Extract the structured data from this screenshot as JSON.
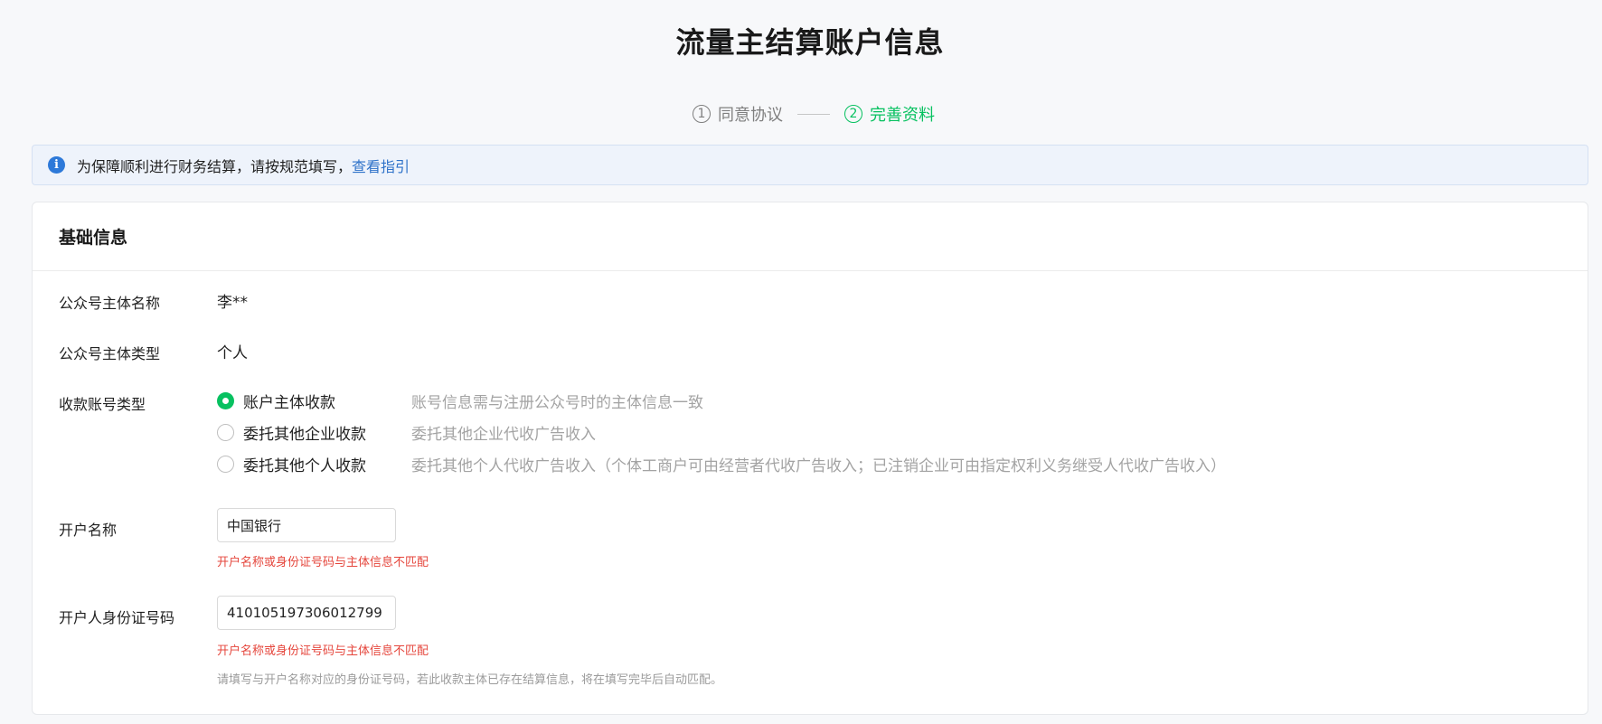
{
  "page": {
    "title": "流量主结算账户信息"
  },
  "steps": [
    {
      "num": "1",
      "label": "同意协议",
      "state": "done"
    },
    {
      "num": "2",
      "label": "完善资料",
      "state": "active"
    }
  ],
  "notice": {
    "text": "为保障顺利进行财务结算，请按规范填写，",
    "link": "查看指引"
  },
  "section": {
    "title": "基础信息"
  },
  "fields": {
    "entity_name": {
      "label": "公众号主体名称",
      "value": "李**"
    },
    "entity_type": {
      "label": "公众号主体类型",
      "value": "个人"
    },
    "account_type": {
      "label": "收款账号类型",
      "options": [
        {
          "label": "账户主体收款",
          "desc": "账号信息需与注册公众号时的主体信息一致",
          "checked": true
        },
        {
          "label": "委托其他企业收款",
          "desc": "委托其他企业代收广告收入",
          "checked": false
        },
        {
          "label": "委托其他个人收款",
          "desc": "委托其他个人代收广告收入（个体工商户可由经营者代收广告收入；已注销企业可由指定权利义务继受人代收广告收入）",
          "checked": false
        }
      ]
    },
    "account_name": {
      "label": "开户名称",
      "value": "中国银行",
      "error": "开户名称或身份证号码与主体信息不匹配"
    },
    "id_number": {
      "label": "开户人身份证号码",
      "value": "410105197306012799",
      "error": "开户名称或身份证号码与主体信息不匹配",
      "hint": "请填写与开户名称对应的身份证号码，若此收款主体已存在结算信息，将在填写完毕后自动匹配。"
    }
  },
  "colors": {
    "accent": "#07c160",
    "error": "#e5463c",
    "link": "#2e72c9",
    "info": "#2d79d9"
  }
}
